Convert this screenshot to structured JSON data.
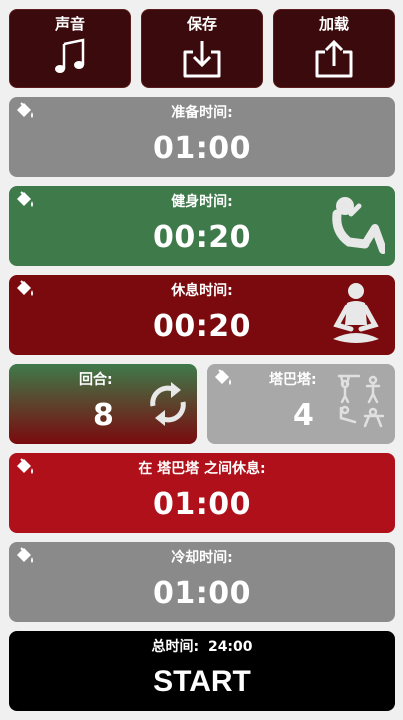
{
  "toolbar": {
    "sound_label": "声音",
    "save_label": "保存",
    "load_label": "加载"
  },
  "prepare": {
    "title": "准备时间:",
    "value": "01:00",
    "color": "#8a8a8a"
  },
  "work": {
    "title": "健身时间:",
    "value": "00:20",
    "color": "#3f7a4a"
  },
  "rest": {
    "title": "休息时间:",
    "value": "00:20",
    "color": "#7a0a0e"
  },
  "rounds": {
    "title": "回合:",
    "value": "8"
  },
  "tabata": {
    "title": "塔巴塔:",
    "value": "4"
  },
  "between": {
    "title": "在 塔巴塔 之间休息:",
    "value": "01:00",
    "color": "#b0101a"
  },
  "cooldown": {
    "title": "冷却时间:",
    "value": "01:00",
    "color": "#8a8a8a"
  },
  "start": {
    "total_label": "总时间:",
    "total_value": "24:00",
    "label": "START"
  }
}
